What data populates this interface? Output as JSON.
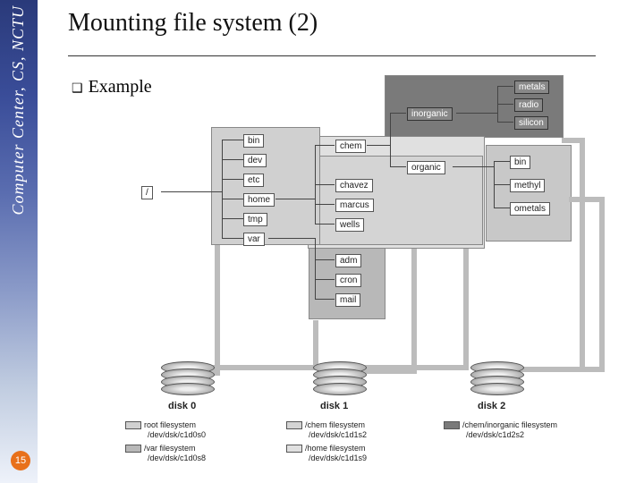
{
  "sidebar": {
    "text": "Computer Center, CS, NCTU"
  },
  "title": "Mounting file system (2)",
  "example_label": "Example",
  "page_number": "15",
  "diagram": {
    "root": {
      "slash": "/",
      "bin": "bin",
      "dev": "dev",
      "etc": "etc",
      "home": "home",
      "tmp": "tmp",
      "var": "var"
    },
    "var": {
      "adm": "adm",
      "cron": "cron",
      "mail": "mail"
    },
    "chem": {
      "label": "chem",
      "organic": "organic",
      "chavez": "chavez",
      "marcus": "marcus",
      "wells": "wells"
    },
    "inorganic": {
      "label": "inorganic",
      "metals": "metals",
      "radio": "radio",
      "silicon": "silicon"
    },
    "bmo": {
      "bin": "bin",
      "methyl": "methyl",
      "ometals": "ometals"
    },
    "disks": {
      "d0": "disk 0",
      "d1": "disk 1",
      "d2": "disk 2"
    },
    "legend": {
      "root_fs": "root filesystem",
      "root_dev": "/dev/dsk/c1d0s0",
      "var_fs": "/var filesystem",
      "var_dev": "/dev/dsk/c1d0s8",
      "chem_fs": "/chem filesystem",
      "chem_dev": "/dev/dsk/c1d1s2",
      "home_fs": "/home filesystem",
      "home_dev": "/dev/dsk/c1d1s9",
      "inorg_fs": "/chem/inorganic filesystem",
      "inorg_dev": "/dev/dsk/c1d2s2"
    }
  }
}
